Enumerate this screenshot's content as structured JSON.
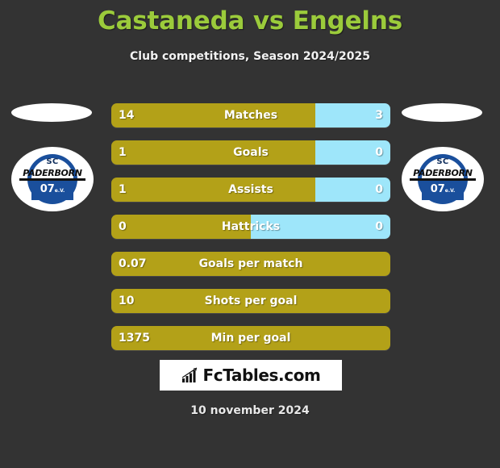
{
  "header": {
    "title": "Castaneda vs Engelns",
    "subtitle": "Club competitions, Season 2024/2025",
    "title_color": "#9bcb3b"
  },
  "teams": {
    "home": {
      "crest_sc": "SC",
      "crest_name": "PADERBORN",
      "crest_year": "07",
      "crest_suffix": "e.V."
    },
    "away": {
      "crest_sc": "SC",
      "crest_name": "PADERBORN",
      "crest_year": "07",
      "crest_suffix": "e.V."
    }
  },
  "colors": {
    "background": "#333333",
    "home_bar": "#b3a118",
    "away_bar": "#9ee6fa",
    "text": "#ffffff"
  },
  "chart_data": {
    "type": "bar",
    "title": "Castaneda vs Engelns",
    "subtitle": "Club competitions, Season 2024/2025",
    "orientation": "horizontal-paired",
    "series": [
      {
        "name": "Castaneda",
        "color": "#b3a118",
        "values": [
          14,
          1,
          1,
          0,
          0.07,
          10,
          1375
        ]
      },
      {
        "name": "Engelns",
        "color": "#9ee6fa",
        "values": [
          3,
          0,
          0,
          0,
          null,
          null,
          null
        ]
      }
    ],
    "categories": [
      "Matches",
      "Goals",
      "Assists",
      "Hattricks",
      "Goals per match",
      "Shots per goal",
      "Min per goal"
    ],
    "rows": [
      {
        "label": "Matches",
        "home": "14",
        "away": "3",
        "home_pct": 73,
        "away_pct": 27,
        "has_away": true
      },
      {
        "label": "Goals",
        "home": "1",
        "away": "0",
        "home_pct": 73,
        "away_pct": 27,
        "has_away": true
      },
      {
        "label": "Assists",
        "home": "1",
        "away": "0",
        "home_pct": 73,
        "away_pct": 27,
        "has_away": true
      },
      {
        "label": "Hattricks",
        "home": "0",
        "away": "0",
        "home_pct": 50,
        "away_pct": 50,
        "has_away": true
      },
      {
        "label": "Goals per match",
        "home": "0.07",
        "away": "",
        "home_pct": 100,
        "away_pct": 0,
        "has_away": false
      },
      {
        "label": "Shots per goal",
        "home": "10",
        "away": "",
        "home_pct": 100,
        "away_pct": 0,
        "has_away": false
      },
      {
        "label": "Min per goal",
        "home": "1375",
        "away": "",
        "home_pct": 100,
        "away_pct": 0,
        "has_away": false
      }
    ]
  },
  "footer": {
    "brand": "FcTables.com",
    "brand_icon": "bar-chart-growth-icon",
    "date": "10 november 2024"
  }
}
